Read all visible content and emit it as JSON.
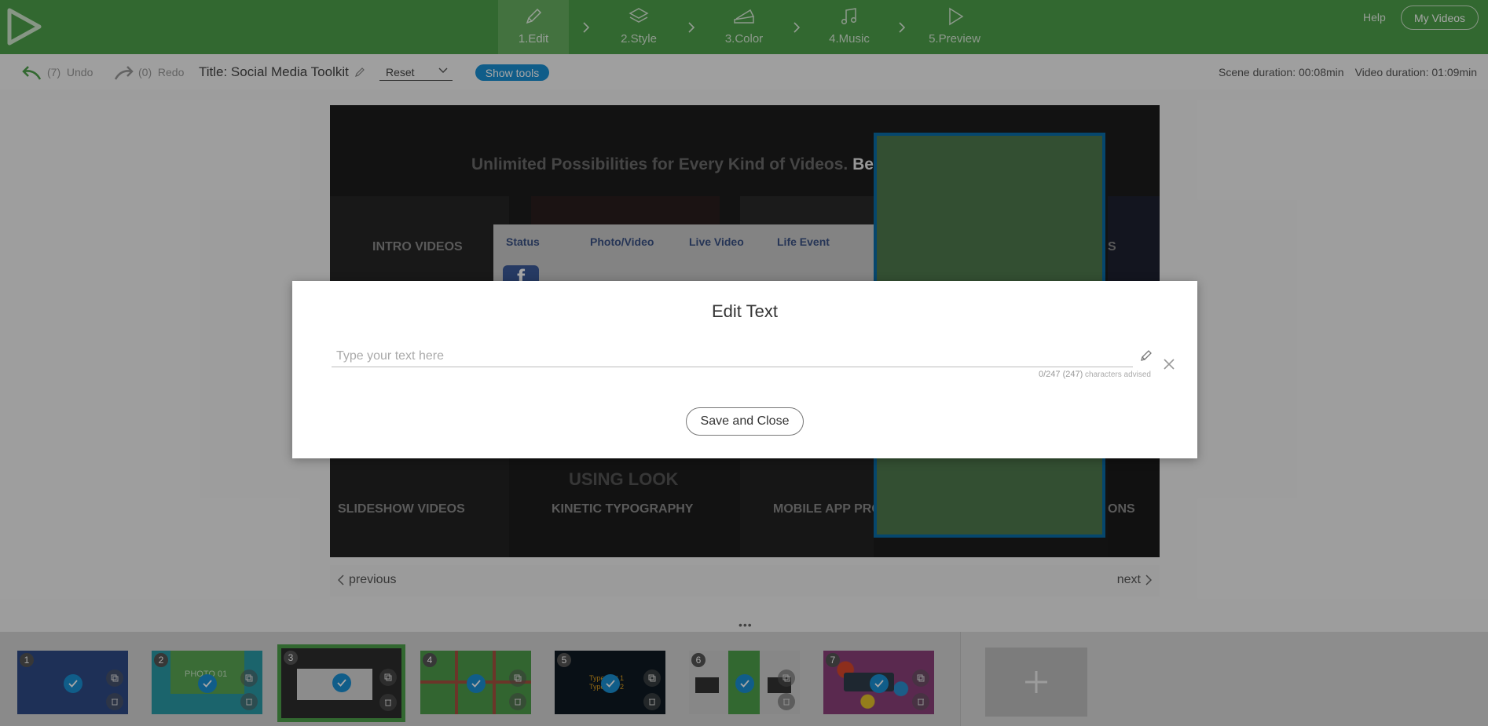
{
  "nav": {
    "steps": [
      {
        "label": "1.Edit",
        "icon": "pencil-icon"
      },
      {
        "label": "2.Style",
        "icon": "layers-icon"
      },
      {
        "label": "3.Color",
        "icon": "palette-icon"
      },
      {
        "label": "4.Music",
        "icon": "music-note-icon"
      },
      {
        "label": "5.Preview",
        "icon": "play-icon"
      }
    ],
    "active_step": "1.Edit",
    "help": "Help",
    "my_videos": "My Videos"
  },
  "toolbar": {
    "undo_count": "(7)",
    "undo_label": "Undo",
    "redo_count": "(0)",
    "redo_label": "Redo",
    "title": "Title: Social Media Toolkit",
    "reset_value": "Reset",
    "show_tools": "Show tools",
    "scene_duration": "Scene duration: 00:08min",
    "video_duration": "Video duration: 01:09min"
  },
  "canvas": {
    "headline_dim": "Unlimited Possibilities for Every Kind of Videos.",
    "headline_bold": "Be",
    "tiles_top": [
      "INTRO VIDEOS",
      "S"
    ],
    "tiles_bottom": [
      "SLIDESHOW VIDEOS",
      "KINETIC TYPOGRAPHY",
      "MOBILE APP PRO",
      "ONS"
    ],
    "tile_mid_text": "USING LOOK",
    "fb_items": [
      "Status",
      "Photo/Video",
      "Live Video",
      "Life Event"
    ],
    "fb_logo": "f"
  },
  "pager": {
    "previous": "previous",
    "next": "next",
    "dots": "•••"
  },
  "filmstrip": {
    "scenes": [
      {
        "num": "1",
        "text": ""
      },
      {
        "num": "2",
        "text": "PHOTO 01"
      },
      {
        "num": "3",
        "text": ""
      },
      {
        "num": "4",
        "text": ""
      },
      {
        "num": "5",
        "text": "Type text 1 Type text 2"
      },
      {
        "num": "6",
        "text": ""
      },
      {
        "num": "7",
        "text": ""
      }
    ],
    "active_scene": "3",
    "add_label": "+"
  },
  "modal": {
    "title": "Edit Text",
    "placeholder": "Type your text here",
    "value": "",
    "counter_main": "0/247 (247)",
    "counter_suffix": "characters advised",
    "save_close": "Save and Close"
  },
  "colors": {
    "brand_green": "#4ea04a",
    "accent_blue": "#1a8fd3"
  }
}
